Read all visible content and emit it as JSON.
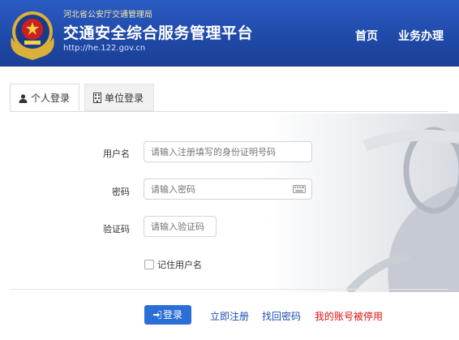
{
  "header": {
    "org_name": "河北省公安厅交通管理局",
    "platform_title": "交通安全综合服务管理平台",
    "site_url": "http://he.122.gov.cn",
    "nav": [
      {
        "label": "首页"
      },
      {
        "label": "业务办理"
      }
    ],
    "bg_color": "#1f4aa8"
  },
  "tabs": [
    {
      "label": "个人登录",
      "icon": "user-icon",
      "active": true
    },
    {
      "label": "单位登录",
      "icon": "building-icon",
      "active": false
    }
  ],
  "form": {
    "username": {
      "label": "用户名",
      "placeholder": "请输入注册填写的身份证明号码"
    },
    "password": {
      "label": "密码",
      "placeholder": "请输入密码",
      "icon": "keyboard-icon"
    },
    "captcha": {
      "label": "验证码",
      "placeholder": "请输入验证码"
    },
    "remember_label": "记住用户名",
    "remember_checked": false
  },
  "actions": {
    "login_label": "登录",
    "login_icon": "sign-in-icon",
    "register_label": "立即注册",
    "find_password_label": "找回密码",
    "account_disabled_label": "我的账号被停用",
    "primary_color": "#2b6fd6",
    "link_color": "#1d4fb3",
    "warning_color": "#e01010"
  }
}
